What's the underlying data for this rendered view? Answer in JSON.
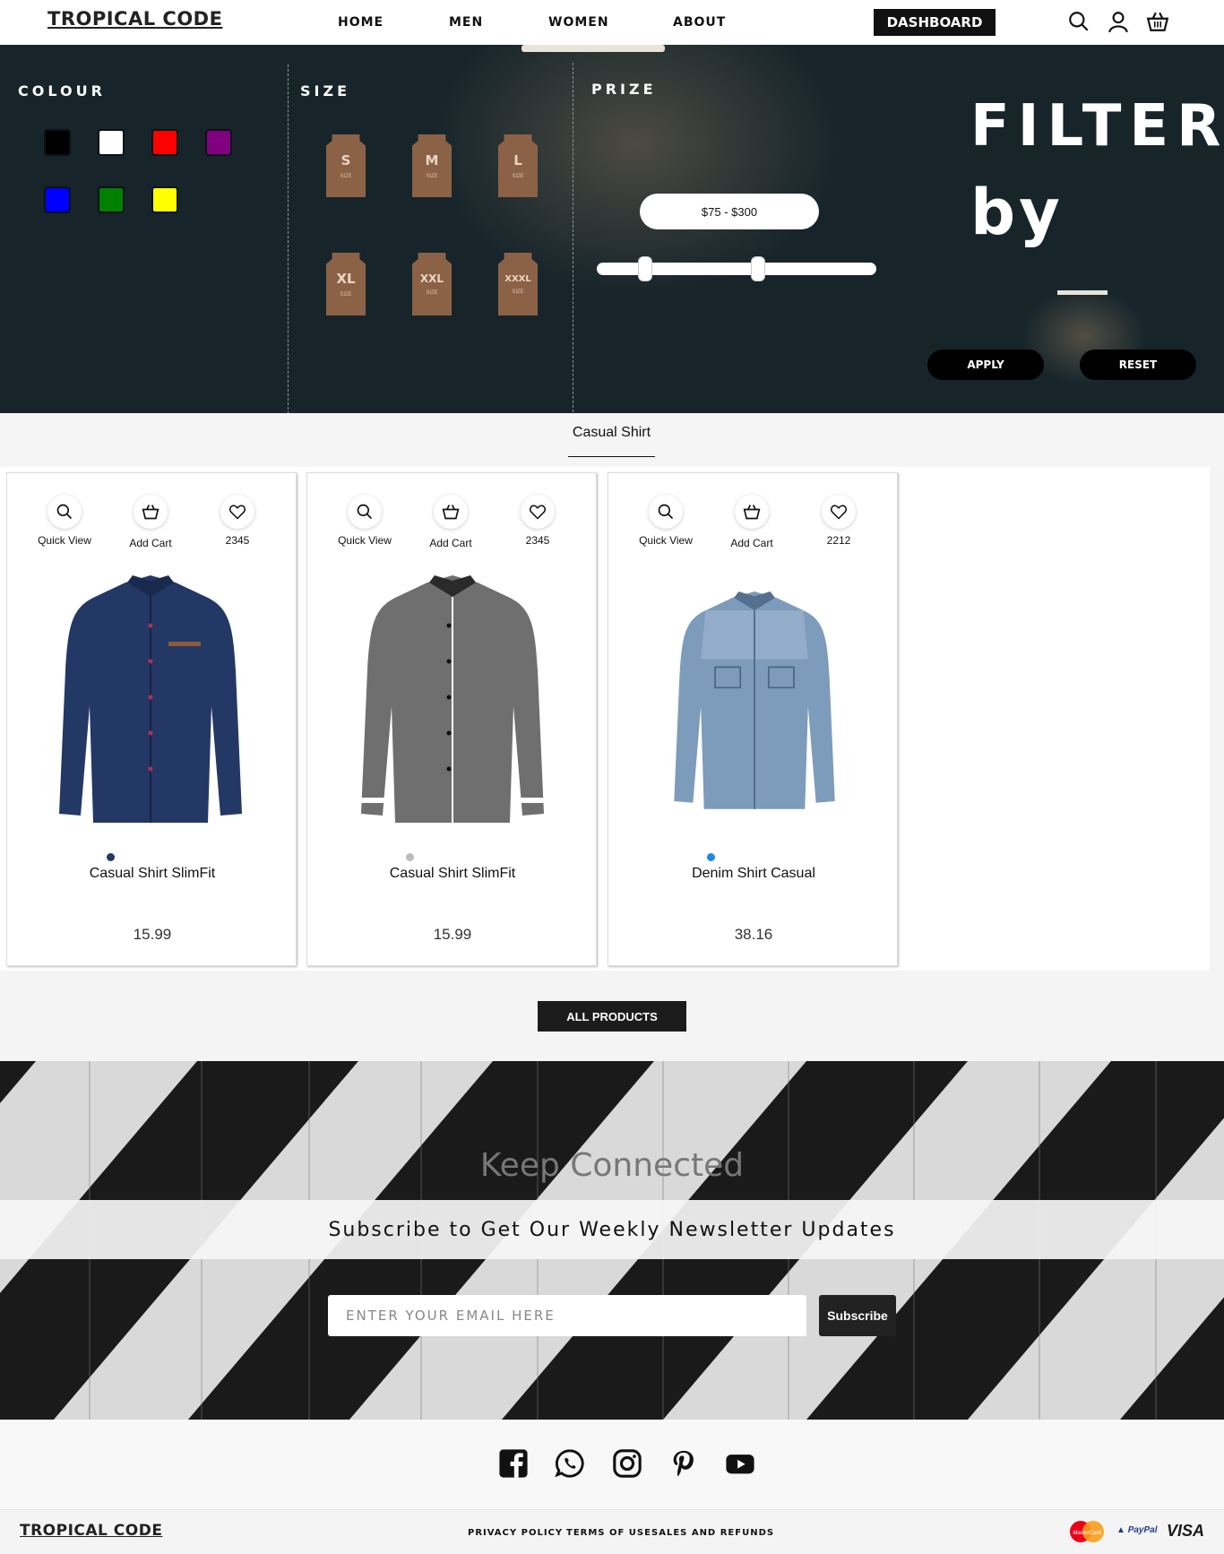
{
  "header": {
    "logo": "TROPICAL CODE",
    "nav": [
      "HOME",
      "MEN",
      "WOMEN",
      "ABOUT"
    ],
    "dashboard": "DASHBOARD",
    "icons": [
      "search-icon",
      "user-icon",
      "basket-icon"
    ]
  },
  "filter": {
    "colour_title": "COLOUR",
    "size_title": "SIZE",
    "prize_title": "PRIZE",
    "colours": [
      "#000000",
      "#ffffff",
      "#ff0000",
      "#800080",
      "#0000ff",
      "#008000",
      "#ffff00"
    ],
    "sizes": [
      "S",
      "M",
      "L",
      "XL",
      "XXL",
      "XXXL"
    ],
    "size_sub": "SIZE",
    "price_range": "$75 - $300",
    "title_line1": "FILTER",
    "title_line2": "by",
    "apply": "APPLY",
    "reset": "RESET"
  },
  "tabs": {
    "active": "Casual Shirt"
  },
  "products": [
    {
      "quick_view": "Quick View",
      "add_cart": "Add Cart",
      "likes": "2345",
      "name": "Casual Shirt SlimFit",
      "price": "15.99",
      "dot_color": "#1f3a66",
      "shirt_color": "#243866"
    },
    {
      "quick_view": "Quick View",
      "add_cart": "Add Cart",
      "likes": "2345",
      "name": "Casual Shirt SlimFit",
      "price": "15.99",
      "dot_color": "#bbbbbb",
      "shirt_color": "#6f6f6f"
    },
    {
      "quick_view": "Quick View",
      "add_cart": "Add Cart",
      "likes": "2212",
      "name": "Denim Shirt Casual",
      "price": "38.16",
      "dot_color": "#1e88e5",
      "shirt_color": "#7d9cbc"
    }
  ],
  "all_products": "ALL PRODUCTS",
  "newsletter": {
    "keep": "Keep Connected",
    "subtitle": "Subscribe to Get Our Weekly Newsletter Updates",
    "placeholder": "ENTER YOUR EMAIL HERE",
    "subscribe": "Subscribe"
  },
  "social": [
    "facebook-icon",
    "whatsapp-icon",
    "instagram-icon",
    "pinterest-icon",
    "youtube-icon"
  ],
  "footer": {
    "logo": "TROPICAL CODE",
    "links": [
      "PRIVACY POLICY",
      "TERMS OF USE",
      "SALES AND REFUNDS"
    ],
    "payments": {
      "mastercard": "MasterCard",
      "paypal": "PayPal",
      "visa": "VISA"
    }
  }
}
